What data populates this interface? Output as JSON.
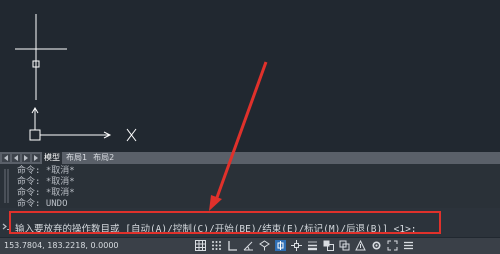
{
  "layout_tabs": {
    "model": "模型",
    "layout1": "布局1",
    "layout2": "布局2"
  },
  "command_history": [
    "命令: *取消*",
    "命令: *取消*",
    "命令: *取消*",
    "命令: UNDO"
  ],
  "command_prompt": "输入要放弃的操作数目或 [自动(A)/控制(C)/开始(BE)/结束(E)/标记(M)/后退(B)] <1>:",
  "status_bar": {
    "coordinates": "153.7804, 183.2218, 0.0000"
  },
  "colors": {
    "canvas_bg": "#212830",
    "highlight": "#e0312b",
    "crosshair": "#ffffff"
  }
}
